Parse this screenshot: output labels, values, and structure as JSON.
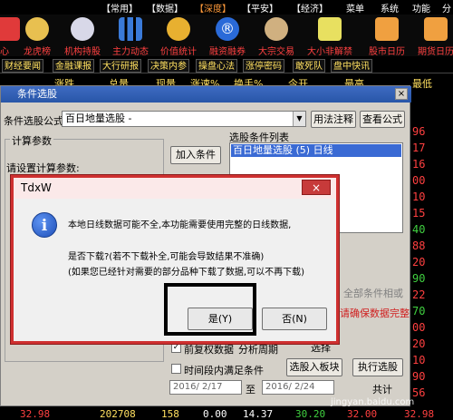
{
  "menubar": {
    "items": [
      {
        "label": "【常用】"
      },
      {
        "label": "【数据】"
      },
      {
        "label": "【深度】"
      },
      {
        "label": "【平安】"
      },
      {
        "label": "【经济】"
      },
      {
        "label": "菜单"
      },
      {
        "label": "系统"
      },
      {
        "label": "功能"
      },
      {
        "label": "分"
      }
    ]
  },
  "toolbar": {
    "items": [
      {
        "label": "心",
        "icon": "heart-icon"
      },
      {
        "label": "龙虎榜",
        "icon": "tiger-icon"
      },
      {
        "label": "机构持股",
        "icon": "institution-icon"
      },
      {
        "label": "主力动态",
        "icon": "bar-chart-icon"
      },
      {
        "label": "价值统计",
        "icon": "coin-icon"
      },
      {
        "label": "融资融券",
        "icon": "registered-icon"
      },
      {
        "label": "大宗交易",
        "icon": "handshake-icon"
      },
      {
        "label": "大小非解禁",
        "icon": "unlock-icon"
      },
      {
        "label": "股市日历",
        "icon": "calendar-icon"
      },
      {
        "label": "期货日历",
        "icon": "calendar-icon"
      }
    ]
  },
  "subtabs": [
    "财经要闻",
    "金融课报",
    "大行研报",
    "决策内参",
    "操盘心法",
    "涨停密码",
    "敢死队",
    "盘中快讯"
  ],
  "grid": {
    "headers": [
      "涨跌",
      "总量",
      "现量",
      "涨速%",
      "换手%",
      "今开",
      "最高",
      "最低"
    ],
    "right_numbers": [
      "96",
      "17",
      "16",
      "00",
      "10",
      "15",
      "40",
      "88",
      "20",
      "90",
      "22",
      "70",
      "00",
      "20",
      "10",
      "90",
      "56"
    ],
    "bottom_row": [
      "32.98",
      "202708",
      "158",
      "0.00",
      "14.37",
      "30.20",
      "32.00",
      "32.98"
    ],
    "right_edge_chars": [
      "低",
      "1",
      "1"
    ]
  },
  "cond_window": {
    "title": "条件选股",
    "close": "×",
    "formula_label": "条件选股公式",
    "formula_value": "百日地量选股 -",
    "usage_btn": "用法注释",
    "view_btn": "查看公式",
    "params_group": "计算参数",
    "params_prompt": "请设置计算参数:",
    "add_btn": "加入条件",
    "list_label": "选股条件列表",
    "list_items": [
      "百日地量选股 (5) 日线"
    ],
    "all_conditions": "全部条件相或",
    "data_warning": "请确保数据完整",
    "prev_rehab": "前复权数据",
    "period_label": "分析周期",
    "select_target": "选择",
    "in_time_label": "时间段内满足条件",
    "select_block_btn": "选股入板块",
    "execute_btn": "执行选股",
    "date_from": "2016/ 2/17",
    "date_to": "2016/ 2/24",
    "to": "至",
    "total_label": "共计"
  },
  "dialog": {
    "title": "TdxW",
    "close": "×",
    "line1": "本地日线数据可能不全,本功能需要使用完整的日线数据,",
    "line2": "是否下载?(若不下载补全,可能会导致结果不准确)",
    "line3": "(如果您已经针对需要的部分品种下载了数据,可以不再下载)",
    "yes": "是(Y)",
    "no": "否(N)"
  },
  "watermark": "jingyan.baidu.com",
  "colors": {
    "accent_red": "#cf3030",
    "title_blue": "#2856a8",
    "list_select": "#3a6ad4",
    "menu_highlight": "#ff9a3a"
  }
}
